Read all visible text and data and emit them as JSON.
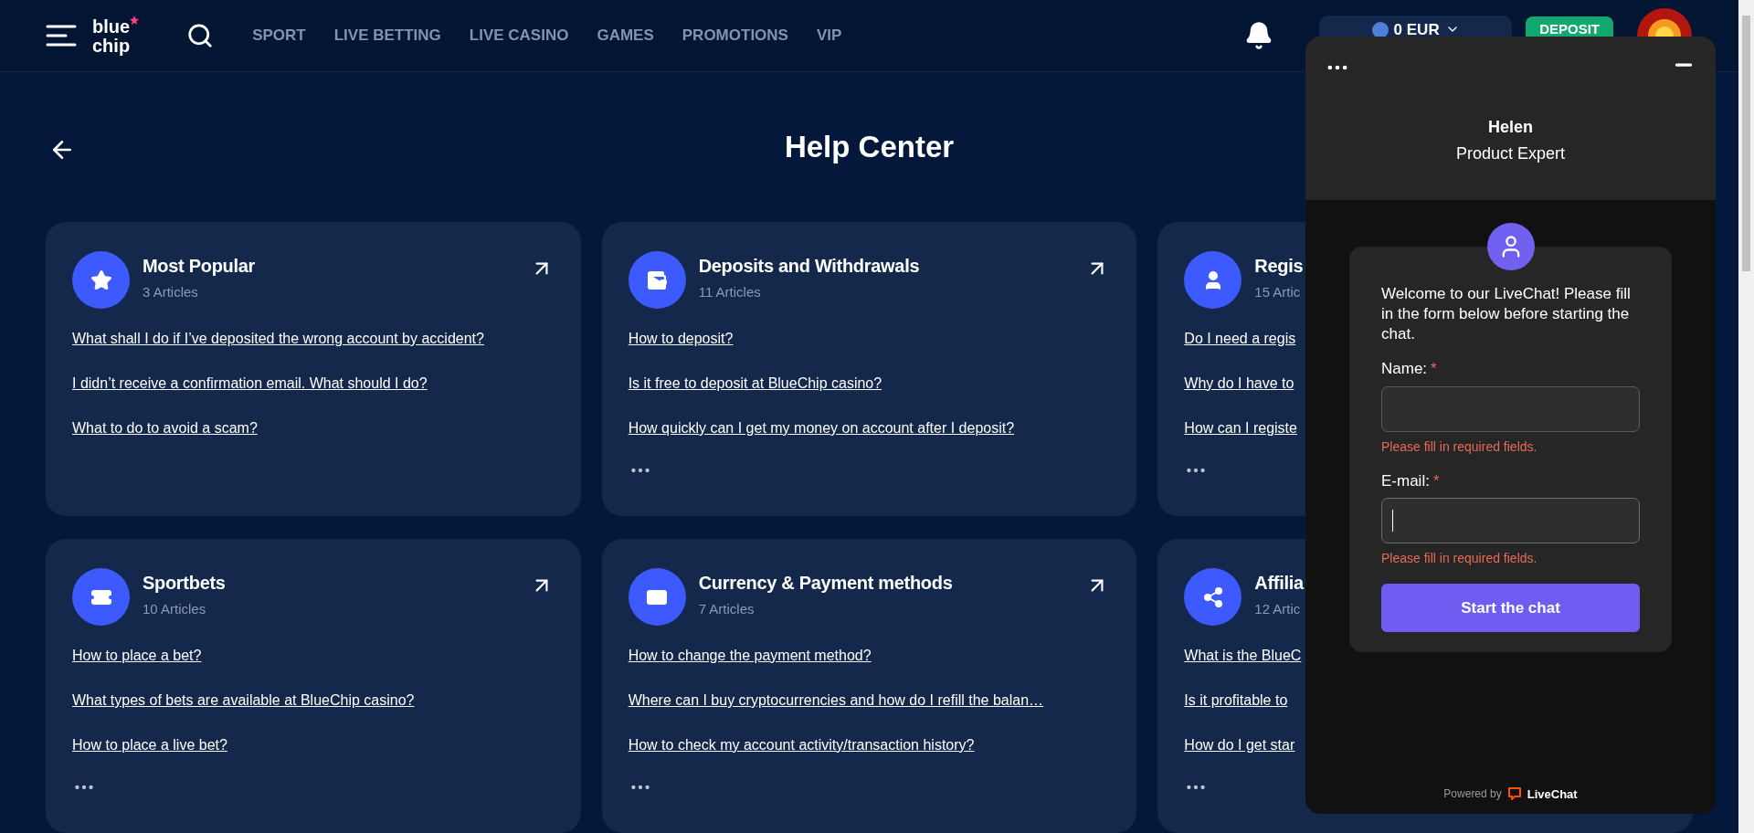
{
  "header": {
    "logo": [
      "blue",
      "chip"
    ],
    "nav": [
      {
        "label": "SPORT"
      },
      {
        "label": "LIVE BETTING"
      },
      {
        "label": "LIVE CASINO"
      },
      {
        "label": "GAMES"
      },
      {
        "label": "PROMOTIONS"
      },
      {
        "label": "VIP"
      }
    ],
    "balance": "0 EUR",
    "deposit": "DEPOSIT"
  },
  "title": "Help Center",
  "categories": [
    {
      "title": "Most Popular",
      "count": "3 Articles",
      "links": [
        "What shall I do if I’ve deposited the wrong account by accident?",
        "I didn’t receive a confirmation email. What should I do?",
        "What to do to avoid a scam?"
      ],
      "more": false
    },
    {
      "title": "Deposits and Withdrawals",
      "count": "11 Articles",
      "links": [
        "How to deposit?",
        "Is it free to deposit at BlueChip casino?",
        "How quickly can I get my money on account after I deposit?"
      ],
      "more": true
    },
    {
      "title": "Regis",
      "count": "15 Artic",
      "links": [
        "Do I need a regis",
        "Why do I have to",
        "How can I registe"
      ],
      "more": true
    },
    {
      "title": "Sportbets",
      "count": "10 Articles",
      "links": [
        "How to place a bet?",
        "What types of bets are available at BlueChip casino?",
        "How to place a live bet?"
      ],
      "more": true
    },
    {
      "title": "Currency & Payment methods",
      "count": "7 Articles",
      "links": [
        "How to change the payment method?",
        "Where can I buy cryptocurrencies and how do I refill the balan…",
        "How to check my account activity/transaction history?"
      ],
      "more": true
    },
    {
      "title": "Affilia",
      "count": "12 Artic",
      "links": [
        "What is the BlueC",
        "Is it profitable to",
        "How do I get star"
      ],
      "more": true
    }
  ],
  "chat": {
    "agent_name": "Helen",
    "agent_role": "Product Expert",
    "welcome": "Welcome to our LiveChat! Please fill in the form below before starting the chat.",
    "fields": [
      {
        "label": "Name:",
        "marker": "*",
        "error": "Please fill in required fields.",
        "focused": false
      },
      {
        "label": "E-mail:",
        "marker": "*",
        "error": "Please fill in required fields.",
        "focused": true
      }
    ],
    "button": "Start the chat",
    "powered_by": "Powered by",
    "brand": "LiveChat"
  }
}
